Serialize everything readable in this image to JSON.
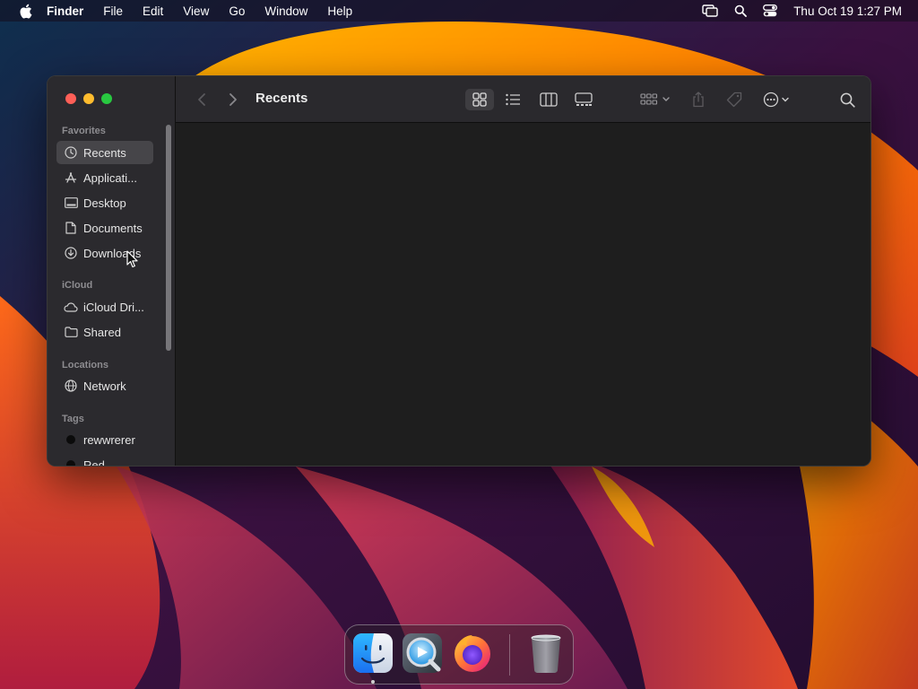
{
  "menubar": {
    "app_name": "Finder",
    "menus": [
      "File",
      "Edit",
      "View",
      "Go",
      "Window",
      "Help"
    ],
    "clock": "Thu Oct 19  1:27 PM",
    "status_icons": [
      "screen-mirroring-icon",
      "spotlight-search-icon",
      "control-center-icon"
    ]
  },
  "window": {
    "title": "Recents",
    "sidebar": {
      "sections": {
        "favorites": "Favorites",
        "icloud": "iCloud",
        "locations": "Locations",
        "tags": "Tags"
      },
      "favorites": [
        "Recents",
        "Applicati...",
        "Desktop",
        "Documents",
        "Downloads"
      ],
      "icloud": [
        "iCloud Dri...",
        "Shared"
      ],
      "locations": [
        "Network"
      ],
      "tags": [
        "rewwrerer",
        "Red"
      ]
    },
    "toolbar_icons": [
      "back-icon",
      "forward-icon",
      "icon-view-icon",
      "list-view-icon",
      "column-view-icon",
      "gallery-view-icon",
      "group-icon",
      "share-icon",
      "tag-icon",
      "more-actions-icon",
      "search-icon"
    ],
    "colors": {
      "close": "#ff5f57",
      "minimize": "#febc2e",
      "maximize": "#28c840",
      "selected_item": "#464549"
    }
  },
  "dock": {
    "apps": [
      "finder-icon",
      "quicktime-player-icon",
      "firefox-icon",
      "trash-icon"
    ]
  }
}
